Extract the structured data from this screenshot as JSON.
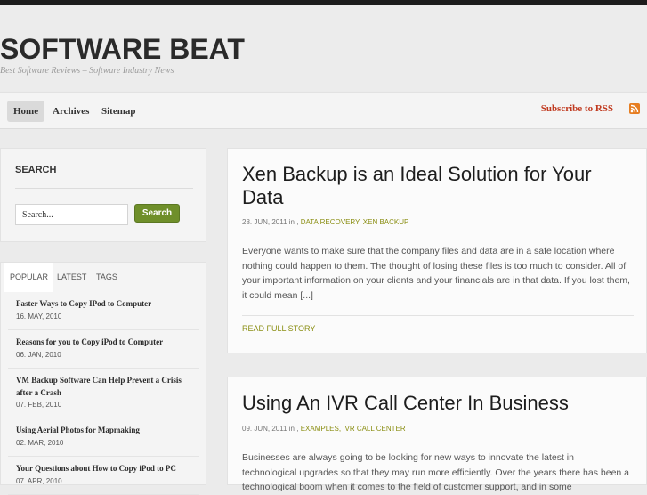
{
  "site": {
    "title": "SOFTWARE BEAT",
    "tagline": "Best Software Reviews – Software Industry News"
  },
  "nav": {
    "items": [
      {
        "label": "Home"
      },
      {
        "label": "Archives"
      },
      {
        "label": "Sitemap"
      }
    ],
    "rss_label": "Subscribe to RSS"
  },
  "search": {
    "title": "SEARCH",
    "input_value": "Search...",
    "button_label": "Search"
  },
  "tabs": {
    "labels": [
      "POPULAR",
      "LATEST",
      "TAGS"
    ],
    "posts": [
      {
        "title": "Faster Ways to Copy IPod to Computer",
        "date": "16. MAY, 2010"
      },
      {
        "title": "Reasons for you to Copy iPod to Computer",
        "date": "06. JAN, 2010"
      },
      {
        "title": "VM Backup Software Can Help Prevent a Crisis after a Crash",
        "date": "07. FEB, 2010"
      },
      {
        "title": "Using Aerial Photos for Mapmaking",
        "date": "02. MAR, 2010"
      },
      {
        "title": "Your Questions about How to Copy iPod to PC",
        "date": "07. APR, 2010"
      }
    ]
  },
  "articles": [
    {
      "title": "Xen Backup is an Ideal Solution for Your Data",
      "date": "28. JUN, 2011",
      "in": "in ,",
      "categories": "DATA RECOVERY, XEN BACKUP",
      "excerpt": "Everyone wants to make sure that the company files and data are in a safe location where nothing could happen to them. The thought of losing these files is too much to consider. All of your important information on your clients and your financials are in that data. If you lost them, it could mean [...]",
      "read_more": "READ FULL STORY"
    },
    {
      "title": "Using An IVR Call Center In Business",
      "date": "09. JUN, 2011",
      "in": "in ,",
      "categories": "EXAMPLES, IVR CALL CENTER",
      "excerpt": "Businesses are always going to be looking for new ways to innovate the latest in technological upgrades so that they may run more efficiently.  Over the years there has been a technological boom when it comes to the field of customer support, and in some"
    }
  ],
  "colors": {
    "accent_green": "#8b8f14",
    "button_green": "#6f8f2a",
    "rss_red": "#c0391e"
  }
}
